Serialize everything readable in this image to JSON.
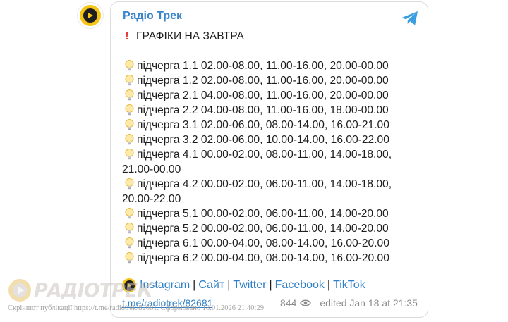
{
  "channel": {
    "name": "Радіо Трек"
  },
  "post": {
    "headline": "ГРАФІКИ НА ЗАВТРА",
    "lines": [
      "підчерга 1.1 02.00-08.00, 11.00-16.00, 20.00-00.00",
      "підчерга 1.2 02.00-08.00, 11.00-16.00, 20.00-00.00",
      "підчерга 2.1 04.00-08.00, 11.00-16.00, 20.00-00.00",
      "підчерга 2.2 04.00-08.00, 11.00-16.00, 18.00-00.00",
      "підчерга 3.1 02.00-06.00, 08.00-14.00, 16.00-21.00",
      "підчерга 3.2 02.00-06.00, 10.00-14.00, 16.00-22.00",
      "підчерга 4.1 00.00-02.00, 08.00-11.00, 14.00-18.00, 21.00-00.00",
      "підчерга 4.2 00.00-02.00, 06.00-11.00, 14.00-18.00, 20.00-22.00",
      "підчерга 5.1 00.00-02.00, 06.00-11.00, 14.00-20.00",
      "підчерга 5.2 00.00-02.00, 06.00-11.00, 14.00-20.00",
      "підчерга 6.1 00.00-04.00, 08.00-14.00, 16.00-20.00",
      "підчерга 6.2 00.00-04.00, 08.00-14.00, 16.00-20.00"
    ],
    "links": [
      "Instagram",
      "Сайт",
      "Twitter",
      "Facebook",
      "TikTok"
    ],
    "link_separator": "|",
    "post_link": "t.me/radiotrek/82681",
    "views": "844",
    "edited": "edited  Jan 18 at 21:35"
  },
  "watermark": {
    "logo_text": "РАДІОТРЕК",
    "caption": "Скріншот публікації https://t.me/radiotrek/82681. Сформовано 18.01.2026 21:40:29"
  },
  "colors": {
    "accent": "#3a86c8",
    "link": "#2f80c8",
    "logo_yellow": "#f5c518",
    "meta": "#8c8c8c"
  },
  "icons": {
    "headline": "red-exclamation-icon",
    "line": "light-bulb-icon",
    "links": "play-logo-icon",
    "views": "eye-icon",
    "app": "telegram-icon"
  }
}
